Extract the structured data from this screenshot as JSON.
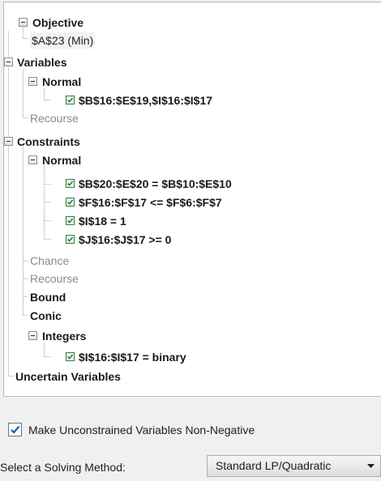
{
  "tree": {
    "objective": {
      "label": "Objective",
      "cell": "$A$23 (Min)"
    },
    "variables": {
      "label": "Variables",
      "normal": {
        "label": "Normal",
        "items": [
          "$B$16:$E$19,$I$16:$I$17"
        ]
      },
      "recourse": "Recourse"
    },
    "constraints": {
      "label": "Constraints",
      "normal": {
        "label": "Normal",
        "items": [
          "$B$20:$E$20 = $B$10:$E$10",
          "$F$16:$F$17 <= $F$6:$F$7",
          "$I$18 = 1",
          "$J$16:$J$17 >= 0"
        ]
      },
      "chance": "Chance",
      "recourse": "Recourse",
      "bound": "Bound",
      "conic": "Conic",
      "integers": {
        "label": "Integers",
        "items": [
          "$I$16:$I$17 = binary"
        ]
      }
    },
    "uncertain_variables": "Uncertain Variables"
  },
  "options": {
    "nonnegative_label": "Make Unconstrained Variables Non-Negative",
    "nonnegative_checked": true
  },
  "solving_method": {
    "label": "Select a Solving Method:",
    "value": "Standard LP/Quadratic"
  },
  "colors": {
    "check_green": "#2f7d3b",
    "checkbox_blue": "#1a5ea8",
    "muted_text": "#8a8a8a"
  }
}
